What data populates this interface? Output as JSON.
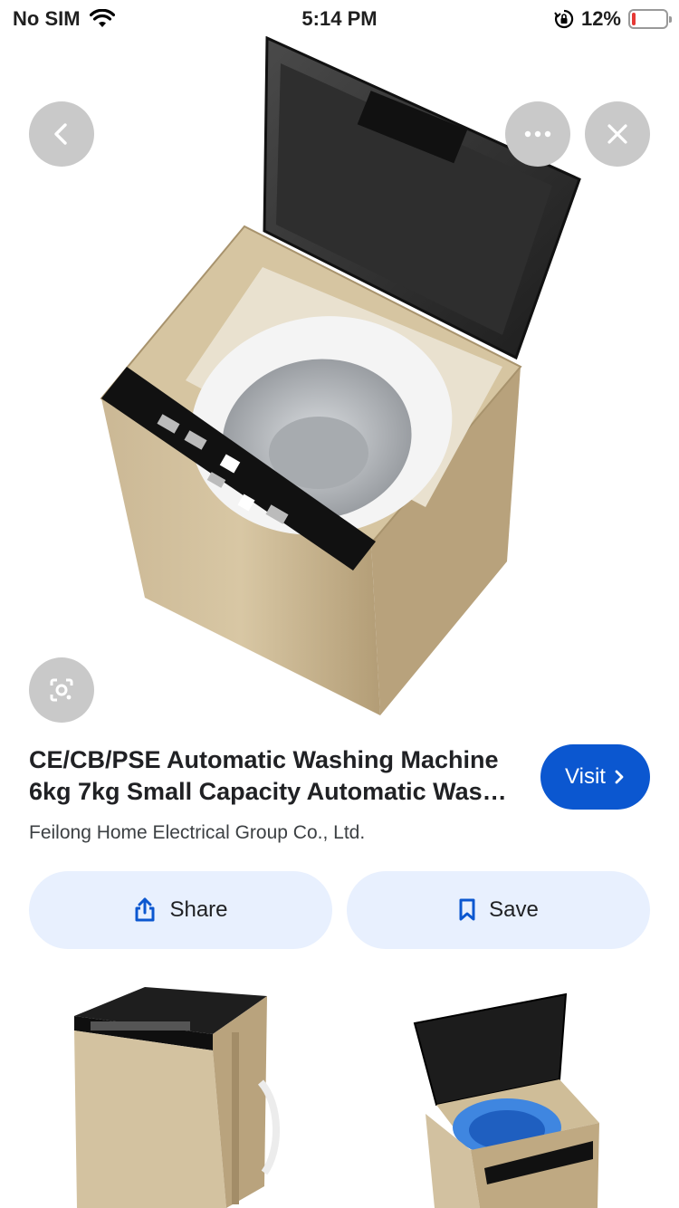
{
  "status_bar": {
    "carrier": "No SIM",
    "time": "5:14 PM",
    "battery": "12%",
    "battery_level": 0.12,
    "battery_color": "#e53935"
  },
  "hero": {
    "icons": {
      "back": "chevron-left-icon",
      "more": "more-horizontal-icon",
      "close": "close-icon",
      "lens": "lens-search-icon"
    }
  },
  "result": {
    "title": "CE/CB/PSE Automatic Washing Machine 6kg 7kg Small Capacity Automatic Was…",
    "source": "Feilong Home Electrical Group Co., Ltd.",
    "visit_label": "Visit"
  },
  "actions": {
    "share_label": "Share",
    "save_label": "Save"
  },
  "colors": {
    "accent": "#0b57d0",
    "chip_bg": "#e8f0fe",
    "overlay_btn": "#c9c9c9"
  }
}
